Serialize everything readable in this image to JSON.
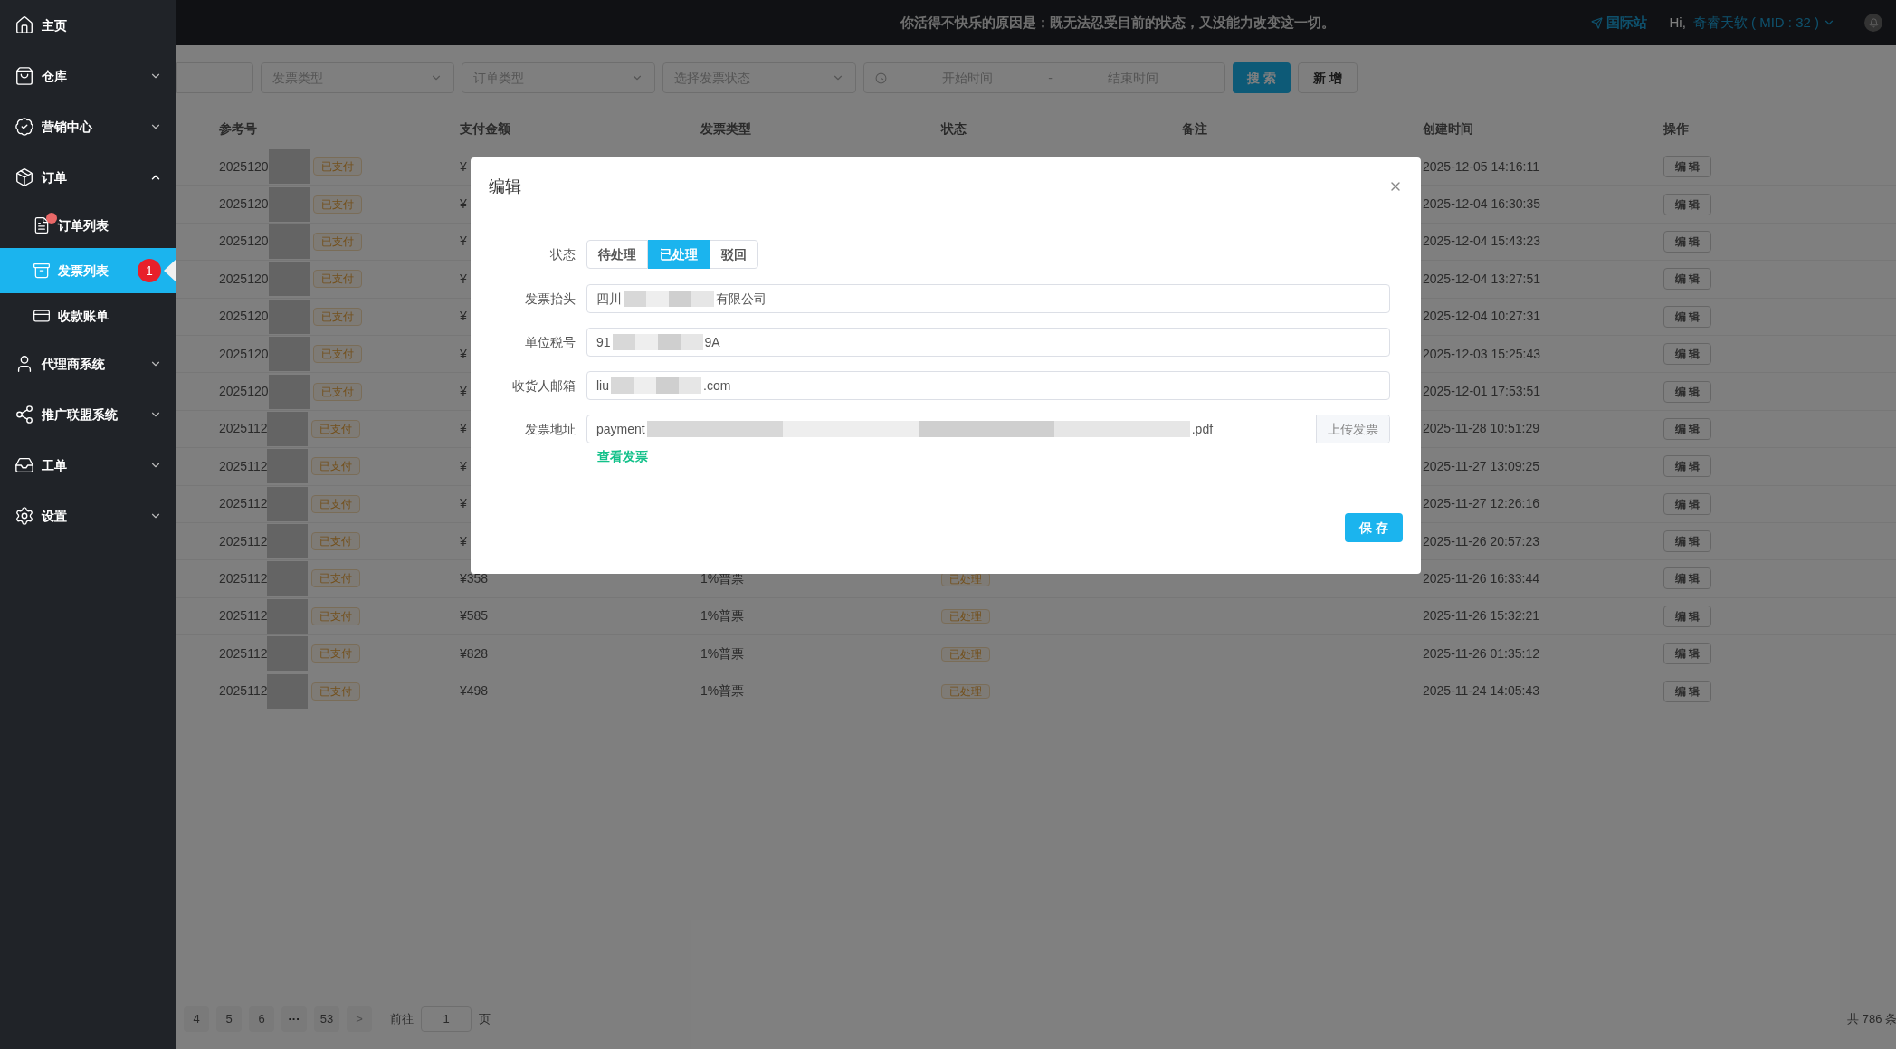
{
  "sidebar": {
    "items": [
      {
        "label": "主页"
      },
      {
        "label": "仓库",
        "expanded": false
      },
      {
        "label": "营销中心",
        "expanded": false
      },
      {
        "label": "订单",
        "expanded": true,
        "children": [
          {
            "label": "订单列表",
            "selected": false,
            "dot": true
          },
          {
            "label": "发票列表",
            "selected": true,
            "dot": false,
            "badge": "1"
          },
          {
            "label": "收款账单",
            "selected": false,
            "dot": false
          }
        ]
      },
      {
        "label": "代理商系统",
        "expanded": false
      },
      {
        "label": "推广联盟系统",
        "expanded": false
      },
      {
        "label": "工单",
        "expanded": false
      },
      {
        "label": "设置",
        "expanded": false
      }
    ]
  },
  "topbar": {
    "motto": "你活得不快乐的原因是：既无法忍受目前的状态，又没能力改变这一切。",
    "link": "国际站",
    "greeting": "Hi,",
    "user": "奇睿天软 ( MID : 32 )"
  },
  "filters": {
    "selects": [
      "发票类型",
      "订单类型",
      "选择发票状态"
    ],
    "start_placeholder": "开始时间",
    "separator": "-",
    "end_placeholder": "结束时间",
    "search_button": "搜 索",
    "add_button": "新 增"
  },
  "table": {
    "columns": [
      "参考号",
      "支付金额",
      "发票类型",
      "状态",
      "备注",
      "创建时间",
      "操作"
    ],
    "rows": [
      {
        "ref": "2025120",
        "paid": "已支付",
        "amount": "¥",
        "created": "2025-12-05 14:16:11",
        "action": "编 辑"
      },
      {
        "ref": "2025120",
        "paid": "已支付",
        "amount": "¥",
        "created": "2025-12-04 16:30:35",
        "action": "编 辑"
      },
      {
        "ref": "2025120",
        "paid": "已支付",
        "amount": "¥",
        "created": "2025-12-04 15:43:23",
        "action": "编 辑"
      },
      {
        "ref": "2025120",
        "paid": "已支付",
        "amount": "¥",
        "created": "2025-12-04 13:27:51",
        "action": "编 辑"
      },
      {
        "ref": "2025120",
        "paid": "已支付",
        "amount": "¥",
        "created": "2025-12-04 10:27:31",
        "action": "编 辑"
      },
      {
        "ref": "2025120",
        "paid": "已支付",
        "amount": "¥",
        "created": "2025-12-03 15:25:43",
        "action": "编 辑"
      },
      {
        "ref": "2025120",
        "paid": "已支付",
        "amount": "¥",
        "created": "2025-12-01 17:53:51",
        "action": "编 辑"
      },
      {
        "ref": "2025112",
        "paid": "已支付",
        "amount": "¥",
        "created": "2025-11-28 10:51:29",
        "action": "编 辑"
      },
      {
        "ref": "2025112",
        "paid": "已支付",
        "amount": "¥",
        "created": "2025-11-27 13:09:25",
        "action": "编 辑"
      },
      {
        "ref": "2025112",
        "paid": "已支付",
        "amount": "¥",
        "created": "2025-11-27 12:26:16",
        "action": "编 辑"
      },
      {
        "ref": "2025112",
        "paid": "已支付",
        "amount": "¥",
        "created": "2025-11-26 20:57:23",
        "action": "编 辑"
      },
      {
        "ref": "2025112",
        "paid": "已支付",
        "amount": "¥358",
        "type": "1%普票",
        "status": "已处理",
        "created": "2025-11-26 16:33:44",
        "action": "编 辑"
      },
      {
        "ref": "2025112",
        "paid": "已支付",
        "amount": "¥585",
        "type": "1%普票",
        "status": "已处理",
        "created": "2025-11-26 15:32:21",
        "action": "编 辑"
      },
      {
        "ref": "2025112",
        "paid": "已支付",
        "amount": "¥828",
        "type": "1%普票",
        "status": "已处理",
        "created": "2025-11-26 01:35:12",
        "action": "编 辑"
      },
      {
        "ref": "2025112",
        "paid": "已支付",
        "amount": "¥498",
        "type": "1%普票",
        "status": "已处理",
        "created": "2025-11-24 14:05:43",
        "action": "编 辑"
      }
    ]
  },
  "pagination": {
    "pages": [
      {
        "label": "4",
        "kind": "page"
      },
      {
        "label": "5",
        "kind": "page"
      },
      {
        "label": "6",
        "kind": "page"
      },
      {
        "label": "···",
        "kind": "more"
      },
      {
        "label": "53",
        "kind": "page"
      },
      {
        "label": ">",
        "kind": "next"
      }
    ],
    "goto": "前往",
    "page_value": "1",
    "page_unit": "页",
    "total": "共 786 条"
  },
  "dialog": {
    "title": "编辑",
    "status_label": "状态",
    "status_options": [
      {
        "label": "待处理",
        "selected": false
      },
      {
        "label": "已处理",
        "selected": true
      },
      {
        "label": "驳回",
        "selected": false
      }
    ],
    "fields": [
      {
        "label": "发票抬头",
        "parts": [
          "四川",
          "有限公司"
        ]
      },
      {
        "label": "单位税号",
        "parts": [
          "91",
          "9A"
        ]
      },
      {
        "label": "收货人邮箱",
        "parts": [
          "liu",
          ".com"
        ]
      },
      {
        "label": "发票地址",
        "parts": [
          "payment",
          ".pdf"
        ],
        "button": "上传发票"
      }
    ],
    "view_link": "查看发票",
    "save_button": "保 存"
  }
}
